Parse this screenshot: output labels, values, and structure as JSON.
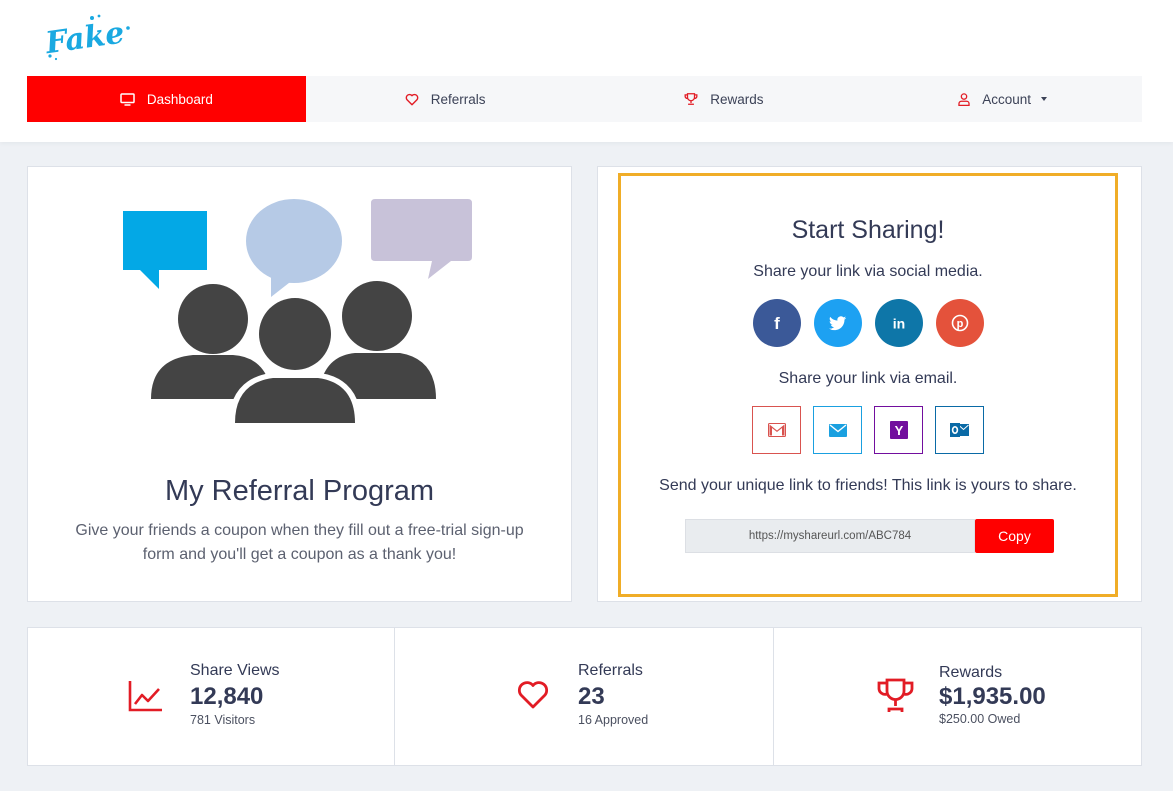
{
  "brand": {
    "logo_text": "Fake",
    "color": "#1aa9e1"
  },
  "nav": {
    "items": [
      {
        "label": "Dashboard",
        "icon": "monitor-icon",
        "active": true
      },
      {
        "label": "Referrals",
        "icon": "heart-icon",
        "active": false
      },
      {
        "label": "Rewards",
        "icon": "trophy-icon",
        "active": false
      },
      {
        "label": "Account",
        "icon": "user-icon",
        "active": false
      }
    ],
    "accent": "#ff0000"
  },
  "program": {
    "title": "My Referral Program",
    "description": "Give your friends a coupon when they fill out a free-trial sign-up form and you'll get a coupon as a thank you!"
  },
  "share": {
    "title": "Start Sharing!",
    "social_label": "Share your link via social media.",
    "social": [
      {
        "name": "facebook",
        "icon": "facebook-icon",
        "color": "#3b5998"
      },
      {
        "name": "twitter",
        "icon": "twitter-icon",
        "color": "#1da1f2"
      },
      {
        "name": "linkedin",
        "icon": "linkedin-icon",
        "color": "#0e76a8"
      },
      {
        "name": "pinterest",
        "icon": "pinterest-icon",
        "color": "#e4523b"
      }
    ],
    "email_label": "Share your link via email.",
    "email": [
      {
        "name": "gmail",
        "icon": "gmail-icon"
      },
      {
        "name": "mail",
        "icon": "mail-icon"
      },
      {
        "name": "yahoo",
        "icon": "yahoo-icon"
      },
      {
        "name": "outlook",
        "icon": "outlook-icon"
      }
    ],
    "link_label": "Send your unique link to friends! This link is yours to share.",
    "link_value": "https://myshareurl.com/ABC784",
    "copy_label": "Copy",
    "border_color": "#f0ad27"
  },
  "stats": [
    {
      "label": "Share Views",
      "value": "12,840",
      "sub": "781 Visitors",
      "icon": "line-chart-icon"
    },
    {
      "label": "Referrals",
      "value": "23",
      "sub": "16 Approved",
      "icon": "heart-icon"
    },
    {
      "label": "Rewards",
      "value": "$1,935.00",
      "sub": "$250.00 Owed",
      "icon": "trophy-icon"
    }
  ]
}
